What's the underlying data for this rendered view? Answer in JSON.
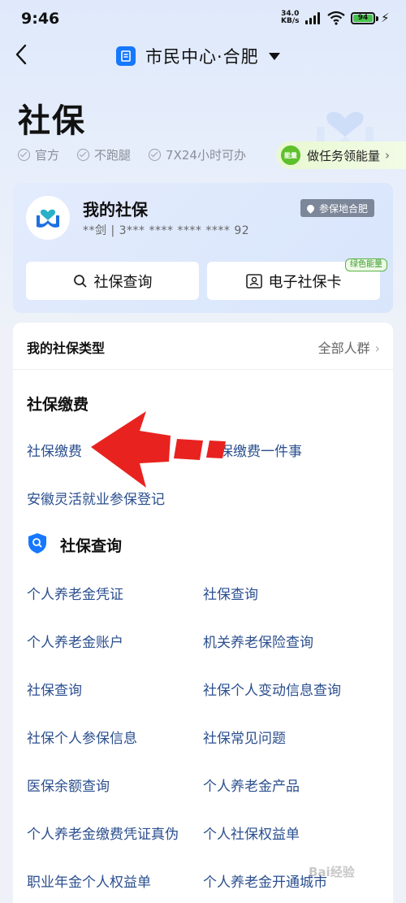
{
  "status_bar": {
    "time": "9:46",
    "speed_value": "34.0",
    "speed_unit": "KB/s",
    "battery": "94"
  },
  "nav": {
    "back_icon": "back-chevron-icon",
    "title": "市民中心·合肥",
    "logo_icon": "citizen-center-icon"
  },
  "page": {
    "title": "社保",
    "tags": [
      "官方",
      "不跑腿",
      "7X24小时可办"
    ],
    "energy_button": "做任务领能量",
    "energy_icon_text": "能量"
  },
  "my_card": {
    "title": "我的社保",
    "subtitle": "**剑 | 3*** **** **** **** 92",
    "location_badge": "参保地合肥",
    "query_button": "社保查询",
    "ecard_button": "电子社保卡",
    "green_tag": "绿色能量"
  },
  "types": {
    "label": "我的社保类型",
    "all": "全部人群"
  },
  "payment": {
    "heading": "社保缴费",
    "links": [
      "社保缴费",
      "保缴费一件事",
      "安徽灵活就业参保登记"
    ]
  },
  "query": {
    "heading": "社保查询",
    "links": [
      [
        "个人养老金凭证",
        "社保查询"
      ],
      [
        "个人养老金账户",
        "机关养老保险查询"
      ],
      [
        "社保查询",
        "社保个人变动信息查询"
      ],
      [
        "社保个人参保信息",
        "社保常见问题"
      ],
      [
        "医保余额查询",
        "个人养老金产品"
      ],
      [
        "个人养老金缴费凭证真伪",
        "个人社保权益单"
      ],
      [
        "职业年金个人权益单",
        "个人养老金开通城市"
      ]
    ]
  },
  "watermark": "Bai经验",
  "colors": {
    "accent": "#1677ff",
    "link": "#2b4f8f",
    "energy_green": "#5ec02b",
    "annotation_red": "#e8231f"
  }
}
